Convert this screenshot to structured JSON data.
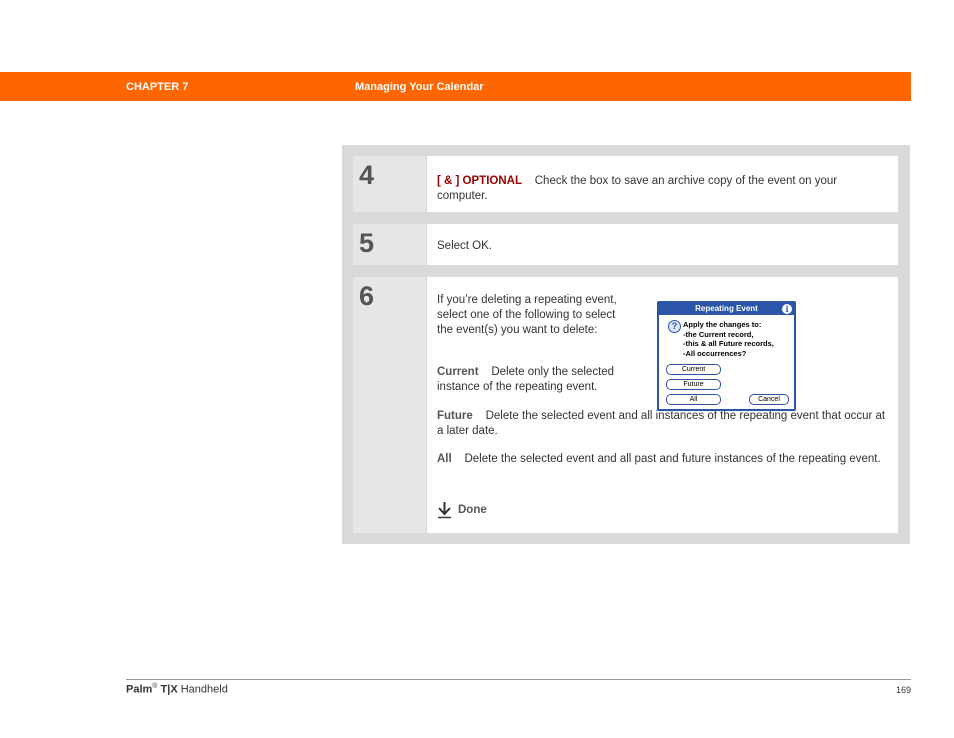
{
  "header": {
    "chapter": "CHAPTER 7",
    "title": "Managing Your Calendar"
  },
  "steps": [
    {
      "number": "4",
      "tag": "[ & ]  OPTIONAL",
      "text": "Check the box to save an archive copy of the event on your computer."
    },
    {
      "number": "5",
      "text": "Select OK."
    },
    {
      "number": "6",
      "intro": "If you’re deleting a repeating event, select one of the following to select the event(s) you want to delete:",
      "options": [
        {
          "term": "Current",
          "desc": "Delete only the selected instance of the repeating event."
        },
        {
          "term": "Future",
          "desc": "Delete the selected event and all instances of the repeating event that occur at a later date."
        },
        {
          "term": "All",
          "desc": "Delete the selected event and all past and future instances of the repeating event."
        }
      ],
      "done_label": "Done"
    }
  ],
  "dialog": {
    "title": "Repeating Event",
    "info_icon": "i",
    "question_icon": "?",
    "lines": [
      "Apply the changes to:",
      "-the Current record,",
      "-this & all Future records,",
      "-All occurrences?"
    ],
    "buttons": {
      "current": "Current",
      "future": "Future",
      "all": "All",
      "cancel": "Cancel"
    }
  },
  "footer": {
    "brand": "Palm",
    "registered": "®",
    "model": "T|X",
    "suffix": "Handheld",
    "page": "169"
  },
  "colors": {
    "header_orange": "#ff6600",
    "optional_red": "#990000",
    "dialog_blue": "#2a55a8"
  }
}
